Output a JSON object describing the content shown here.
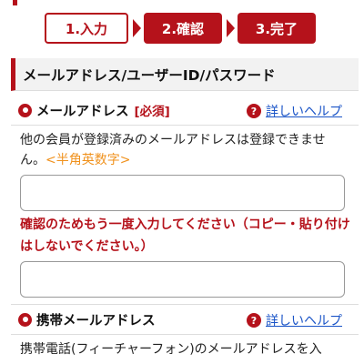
{
  "steps": [
    {
      "label": "1.入力",
      "state": "current"
    },
    {
      "label": "2.確認",
      "state": "pending"
    },
    {
      "label": "3.完了",
      "state": "pending"
    }
  ],
  "section": {
    "title": "メールアドレス/ユーザーID/パスワード"
  },
  "email": {
    "label": "メールアドレス",
    "required": "[必須]",
    "help_link": "詳しいヘルプ",
    "desc": "他の会員が登録済みのメールアドレスは登録できません。",
    "hint": "<半角英数字>",
    "input_value": "",
    "confirm_text": "確認のためもう一度入力してください（コピー・貼り付けはしないでください。）",
    "confirm_value": ""
  },
  "mobile": {
    "label": "携帯メールアドレス",
    "help_link": "詳しいヘルプ",
    "desc": "携帯電話(フィーチャーフォン)のメールアドレスを入"
  },
  "colors": {
    "accent": "#b5121b",
    "link": "#1a54c7",
    "hint": "#f0921e"
  }
}
